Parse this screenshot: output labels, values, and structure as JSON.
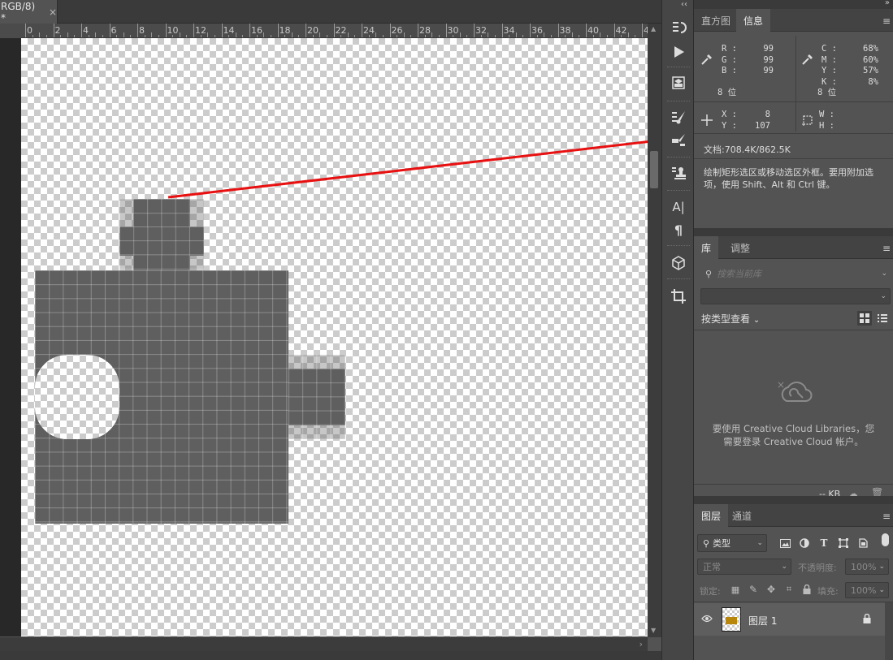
{
  "document": {
    "tab_title": "RGB/8) *",
    "close_glyph": "×"
  },
  "ruler": {
    "labels": [
      "0",
      "2",
      "4",
      "6",
      "8",
      "10",
      "12",
      "14",
      "16",
      "18",
      "20",
      "22",
      "24",
      "26",
      "28",
      "30",
      "32",
      "34",
      "36",
      "38",
      "40",
      "42",
      "4"
    ]
  },
  "toolbar": {
    "collapse_glyph": "‹‹",
    "tools": [
      {
        "name": "history-brush-icon"
      },
      {
        "name": "play-icon"
      },
      {
        "name": "3d-object-icon"
      },
      {
        "name": "brush-settings-icon"
      },
      {
        "name": "clone-source-icon"
      },
      {
        "name": "stamp-icon"
      },
      {
        "name": "character-icon",
        "glyph": "A|"
      },
      {
        "name": "paragraph-icon",
        "glyph": "¶"
      },
      {
        "name": "cube-icon"
      },
      {
        "name": "crop-icon"
      }
    ]
  },
  "info_panel": {
    "tabs": [
      "直方图",
      "信息"
    ],
    "active_tab": "信息",
    "rgb": {
      "r_label": "R :",
      "r": "99",
      "g_label": "G :",
      "g": "99",
      "b_label": "B :",
      "b": "99",
      "bits": "8 位"
    },
    "cmyk": {
      "c_label": "C :",
      "c": "68%",
      "m_label": "M :",
      "m": "60%",
      "y_label": "Y :",
      "y": "57%",
      "k_label": "K :",
      "k": "8%",
      "bits": "8 位"
    },
    "xy": {
      "x_label": "X :",
      "x": "8",
      "y_label": "Y :",
      "y": "107"
    },
    "wh": {
      "w_label": "W :",
      "h_label": "H :"
    },
    "doc_size": "文档:708.4K/862.5K",
    "hint": "绘制矩形选区或移动选区外框。要用附加选项，使用 Shift、Alt 和 Ctrl 键。"
  },
  "libraries_panel": {
    "tabs": [
      "库",
      "调整"
    ],
    "active_tab": "库",
    "search_placeholder": "搜索当前库",
    "view_by_label": "按类型查看",
    "empty_message_line1": "要使用 Creative Cloud Libraries，您",
    "empty_message_line2": "需要登录 Creative Cloud 帐户。",
    "storage": "-- KB"
  },
  "layers_panel": {
    "tabs": [
      "图层",
      "通道"
    ],
    "active_tab": "图层",
    "filter_label": "类型",
    "blend_mode": "正常",
    "opacity_label": "不透明度:",
    "opacity_value": "100%",
    "lock_label": "锁定:",
    "fill_label": "填充:",
    "fill_value": "100%",
    "layers": [
      {
        "name": "图层 1",
        "visible": true,
        "locked": true
      }
    ]
  },
  "colors": {
    "arrow": "#e81010",
    "pixel_fill": "#5f5f5f",
    "panel_bg": "#535353"
  }
}
